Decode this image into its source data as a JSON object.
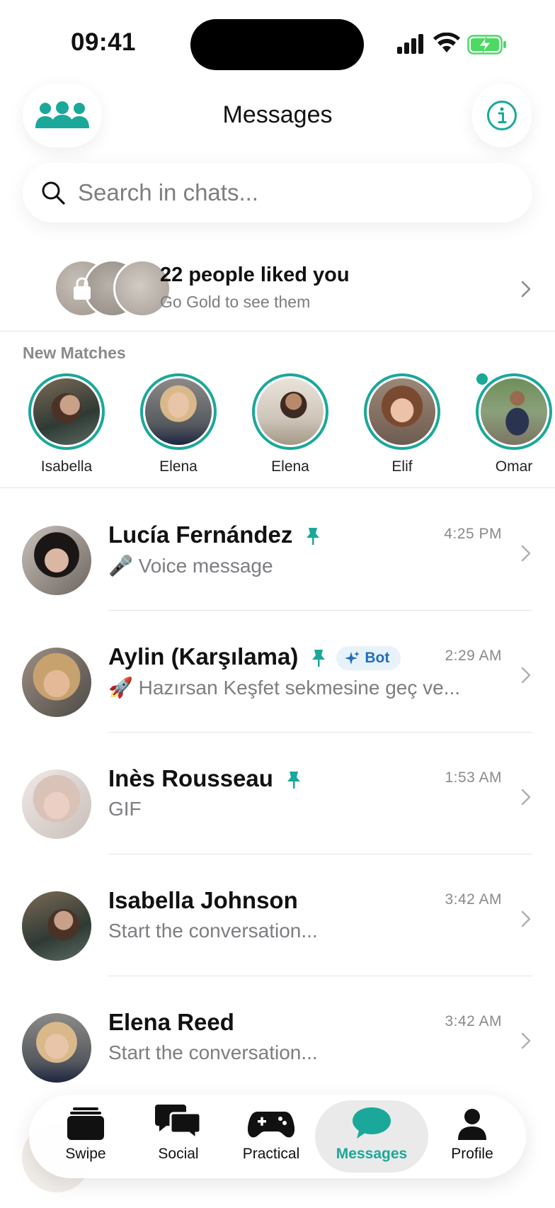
{
  "status_bar": {
    "time": "09:41"
  },
  "header": {
    "title": "Messages",
    "left_icon": "group-icon",
    "right_icon": "info-icon"
  },
  "search": {
    "placeholder": "Search in chats..."
  },
  "likes_banner": {
    "title": "22 people liked you",
    "subtitle": "Go Gold to see them"
  },
  "new_matches": {
    "label": "New Matches",
    "items": [
      {
        "name": "Isabella"
      },
      {
        "name": "Elena"
      },
      {
        "name": "Elena"
      },
      {
        "name": "Elif"
      },
      {
        "name": "Omar"
      }
    ]
  },
  "chats": [
    {
      "name": "Lucía Fernández",
      "pinned": true,
      "time": "4:25 PM",
      "message": "🎤 Voice message"
    },
    {
      "name": "Aylin (Karşılama)",
      "pinned": true,
      "badge": "Bot",
      "time": "2:29 AM",
      "message": "🚀 Hazırsan Keşfet sekmesine geç ve..."
    },
    {
      "name": "Inès Rousseau",
      "pinned": true,
      "time": "1:53 AM",
      "message": "GIF"
    },
    {
      "name": "Isabella Johnson",
      "pinned": false,
      "time": "3:42 AM",
      "message": "Start the conversation..."
    },
    {
      "name": "Elena Reed",
      "pinned": false,
      "time": "3:42 AM",
      "message": "Start the conversation..."
    }
  ],
  "tabbar": {
    "items": [
      {
        "label": "Swipe",
        "icon": "cards-icon"
      },
      {
        "label": "Social",
        "icon": "chat-bubbles-icon"
      },
      {
        "label": "Practical",
        "icon": "gamepad-icon"
      },
      {
        "label": "Messages",
        "icon": "message-bubble-icon",
        "active": true
      },
      {
        "label": "Profile",
        "icon": "person-icon"
      }
    ]
  },
  "colors": {
    "accent": "#1aa89a",
    "bot_badge_bg": "#e8f2fb",
    "bot_badge_text": "#1f6fbf",
    "battery": "#4cd964"
  }
}
